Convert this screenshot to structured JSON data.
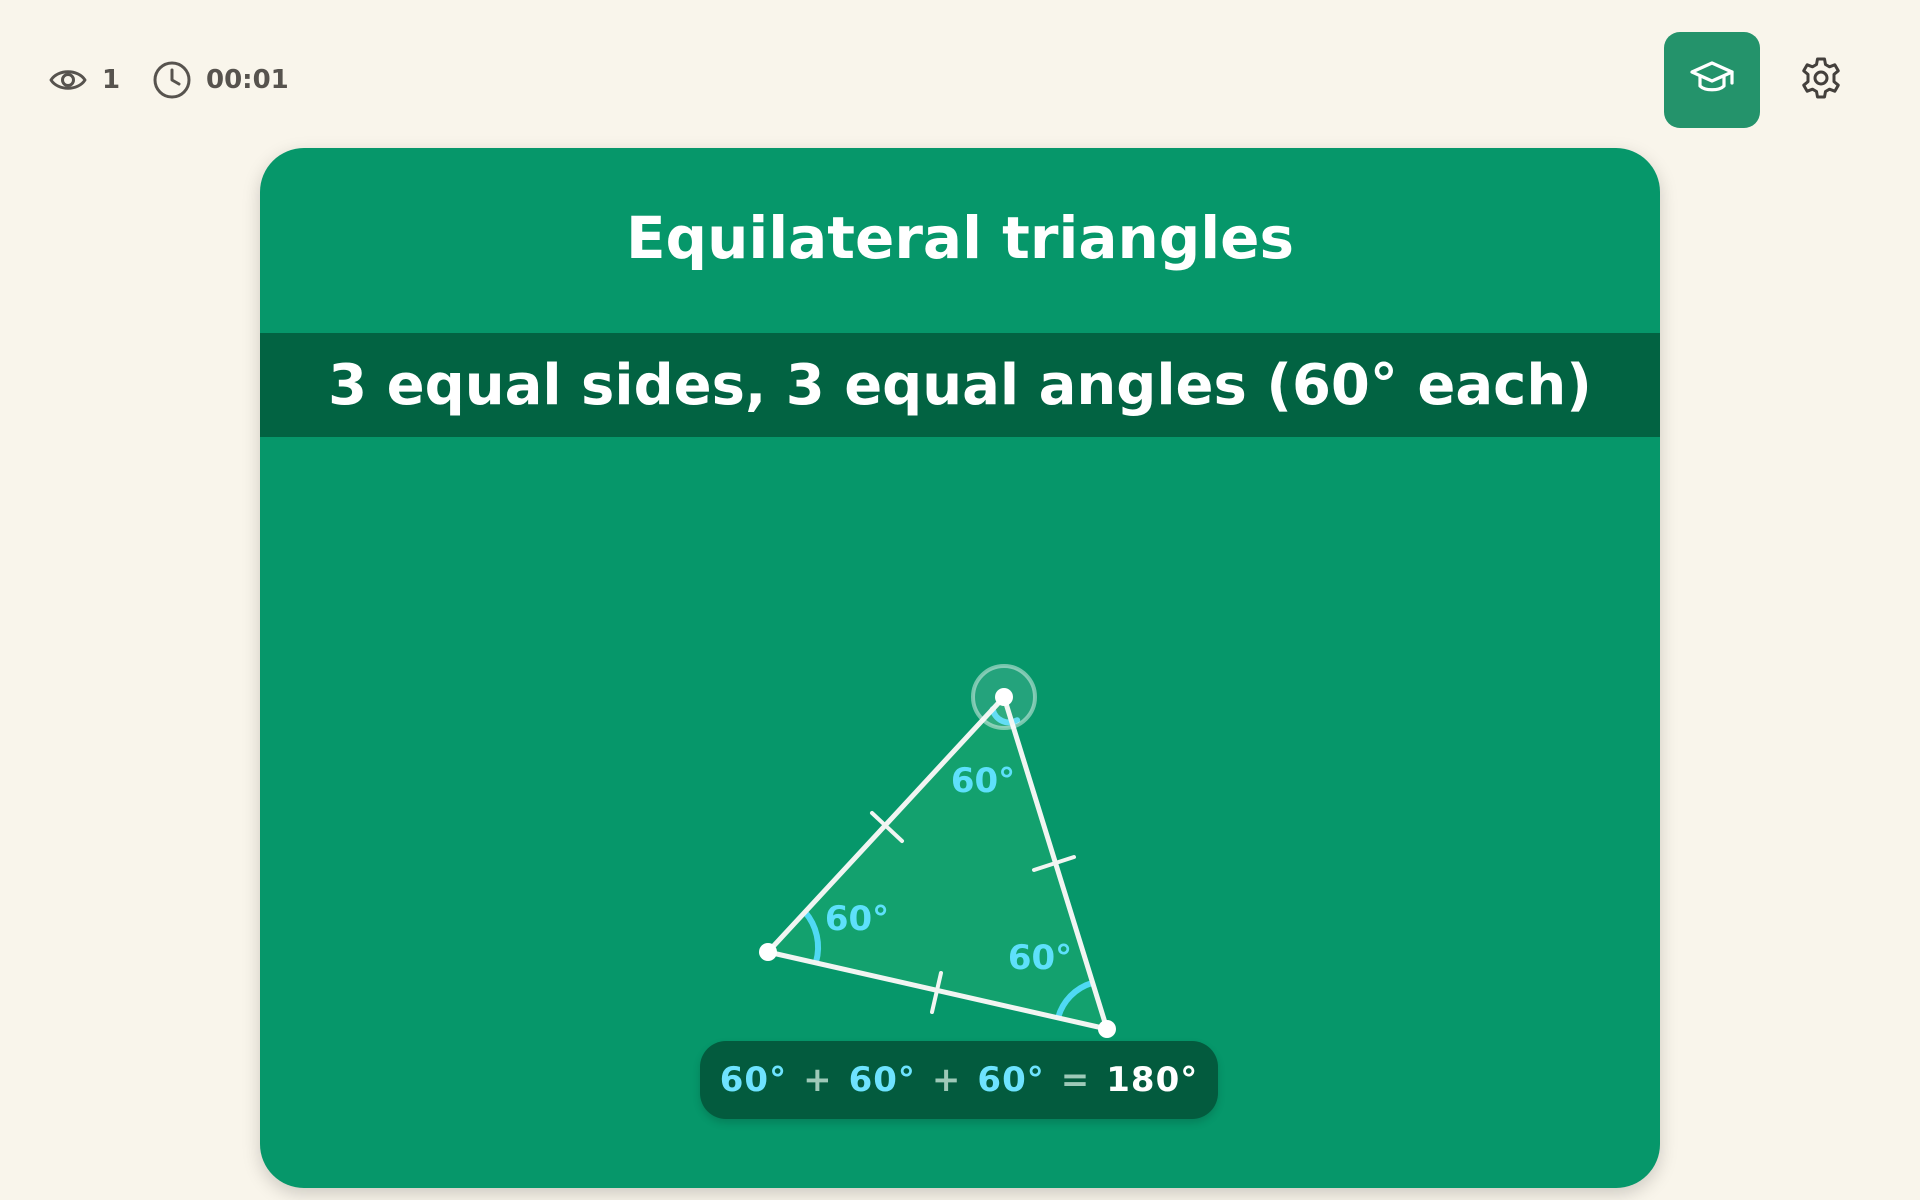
{
  "status": {
    "views": "1",
    "timer": "00:01"
  },
  "icons": {
    "views": "eye-icon",
    "timer": "clock-icon",
    "learn": "graduation-cap-icon",
    "settings": "gear-icon"
  },
  "colors": {
    "background": "#f9f5eb",
    "card": "#06976a",
    "band": "#026342",
    "accent_angle": "#6ee3ff",
    "learn_button": "#24936b"
  },
  "card": {
    "title": "Equilateral triangles",
    "subtitle": "3 equal sides, 3 equal angles (60° each)"
  },
  "triangle": {
    "angle_labels": [
      "60°",
      "60°",
      "60°"
    ]
  },
  "formula": {
    "terms": [
      "60°",
      "60°",
      "60°"
    ],
    "plus": "+",
    "equals": "=",
    "total": "180°"
  }
}
